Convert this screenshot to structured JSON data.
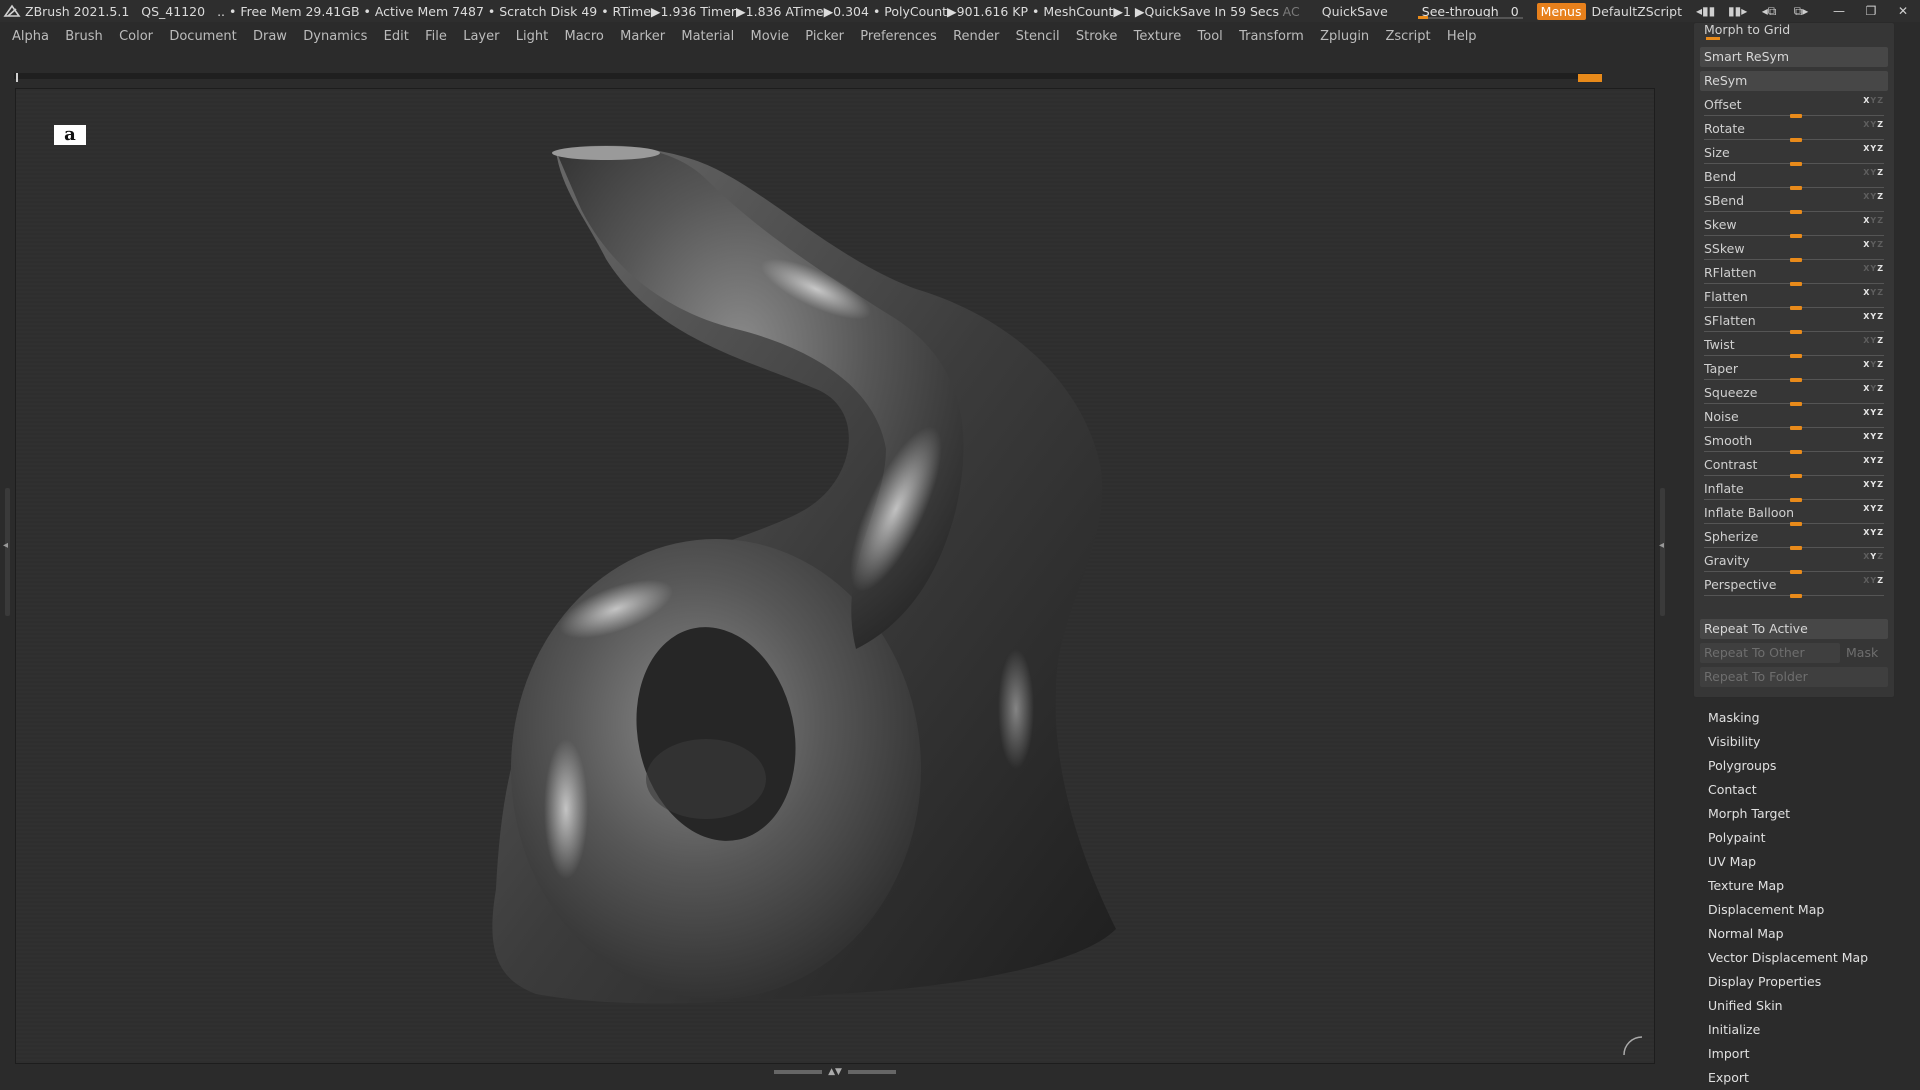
{
  "titlebar": {
    "app_name": "ZBrush 2021.5.1",
    "session_id": "QS_41120",
    "status": ".. • Free Mem 29.41GB • Active Mem 7487 • Scratch Disk 49 •  RTime▶1.936 Timer▶1.836 ATime▶0.304 • PolyCount▶901.616 KP  • MeshCount▶1  ▶QuickSave In 59 Secs",
    "ac_label": "AC",
    "quicksave_label": "QuickSave",
    "seethrough_label": "See-through",
    "seethrough_value": "0",
    "seethrough_level": 0,
    "menus_label": "Menus",
    "script_name": "DefaultZScript",
    "accent_color": "#e88a1a"
  },
  "menubar": {
    "items": [
      "Alpha",
      "Brush",
      "Color",
      "Document",
      "Draw",
      "Dynamics",
      "Edit",
      "File",
      "Layer",
      "Light",
      "Macro",
      "Marker",
      "Material",
      "Movie",
      "Picker",
      "Preferences",
      "Render",
      "Stencil",
      "Stroke",
      "Texture",
      "Tool",
      "Transform",
      "Zplugin",
      "Zscript",
      "Help"
    ]
  },
  "viewport": {
    "logo_text": "a",
    "model_color": "#4a4a4a"
  },
  "palette": {
    "morph_to_grid": "Morph to Grid",
    "smart_resym": "Smart ReSym",
    "resym": "ReSym",
    "sliders": [
      {
        "label": "Offset",
        "x": 1,
        "y": 0,
        "z": 0,
        "value": 0
      },
      {
        "label": "Rotate",
        "x": 0,
        "y": 0,
        "z": 1,
        "value": 0
      },
      {
        "label": "Size",
        "x": 1,
        "y": 1,
        "z": 1,
        "value": 0
      },
      {
        "label": "Bend",
        "x": 0,
        "y": 0,
        "z": 1,
        "value": 0
      },
      {
        "label": "SBend",
        "x": 0,
        "y": 0,
        "z": 1,
        "value": 0
      },
      {
        "label": "Skew",
        "x": 1,
        "y": 0,
        "z": 0,
        "value": 0
      },
      {
        "label": "SSkew",
        "x": 1,
        "y": 0,
        "z": 0,
        "value": 0
      },
      {
        "label": "RFlatten",
        "x": 0,
        "y": 0,
        "z": 1,
        "value": 0
      },
      {
        "label": "Flatten",
        "x": 1,
        "y": 0,
        "z": 0,
        "value": 0
      },
      {
        "label": "SFlatten",
        "x": 1,
        "y": 1,
        "z": 1,
        "value": 0
      },
      {
        "label": "Twist",
        "x": 0,
        "y": 0,
        "z": 1,
        "value": 0
      },
      {
        "label": "Taper",
        "x": 1,
        "y": 0,
        "z": 1,
        "value": 0
      },
      {
        "label": "Squeeze",
        "x": 1,
        "y": 0,
        "z": 1,
        "value": 0
      },
      {
        "label": "Noise",
        "x": 1,
        "y": 1,
        "z": 1,
        "value": 0
      },
      {
        "label": "Smooth",
        "x": 1,
        "y": 1,
        "z": 1,
        "value": 0
      },
      {
        "label": "Contrast",
        "x": 1,
        "y": 1,
        "z": 1,
        "value": 0
      },
      {
        "label": "Inflate",
        "x": 1,
        "y": 1,
        "z": 1,
        "value": 0
      },
      {
        "label": "Inflate Balloon",
        "x": 1,
        "y": 1,
        "z": 1,
        "value": 0
      },
      {
        "label": "Spherize",
        "x": 1,
        "y": 1,
        "z": 1,
        "value": 0
      },
      {
        "label": "Gravity",
        "x": 0,
        "y": 1,
        "z": 0,
        "value": 0
      },
      {
        "label": "Perspective",
        "x": 0,
        "y": 0,
        "z": 1,
        "value": 0
      }
    ],
    "repeat_to_active": "Repeat To Active",
    "repeat_to_other": "Repeat To Other",
    "mask": "Mask",
    "repeat_to_folder": "Repeat To Folder"
  },
  "sublist": {
    "items": [
      "Masking",
      "Visibility",
      "Polygroups",
      "Contact",
      "Morph Target",
      "Polypaint",
      "UV Map",
      "Texture Map",
      "Displacement Map",
      "Normal Map",
      "Vector Displacement Map",
      "Display Properties",
      "Unified Skin",
      "Initialize",
      "Import",
      "Export"
    ]
  }
}
